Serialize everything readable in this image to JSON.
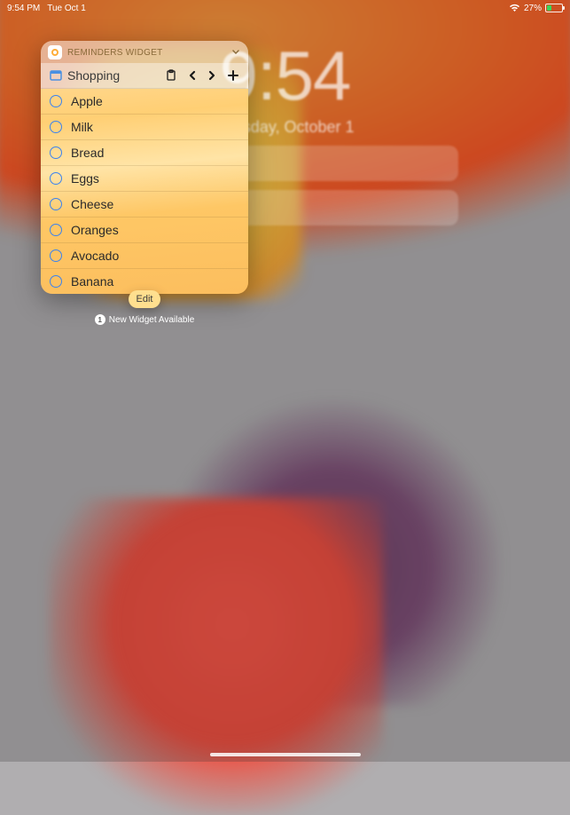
{
  "status": {
    "time": "9:54 PM",
    "date_short": "Tue Oct 1",
    "battery_pct": "27%"
  },
  "lock": {
    "time": "9:54",
    "date": "Tuesday, October 1"
  },
  "widget": {
    "title": "REMINDERS WIDGET",
    "list_name": "Shopping",
    "items": [
      {
        "label": "Apple"
      },
      {
        "label": "Milk"
      },
      {
        "label": "Bread"
      },
      {
        "label": "Eggs"
      },
      {
        "label": "Cheese"
      },
      {
        "label": "Oranges"
      },
      {
        "label": "Avocado"
      },
      {
        "label": "Banana"
      }
    ]
  },
  "edit_label": "Edit",
  "new_widget_label": "New Widget Available",
  "badge_count": "1"
}
